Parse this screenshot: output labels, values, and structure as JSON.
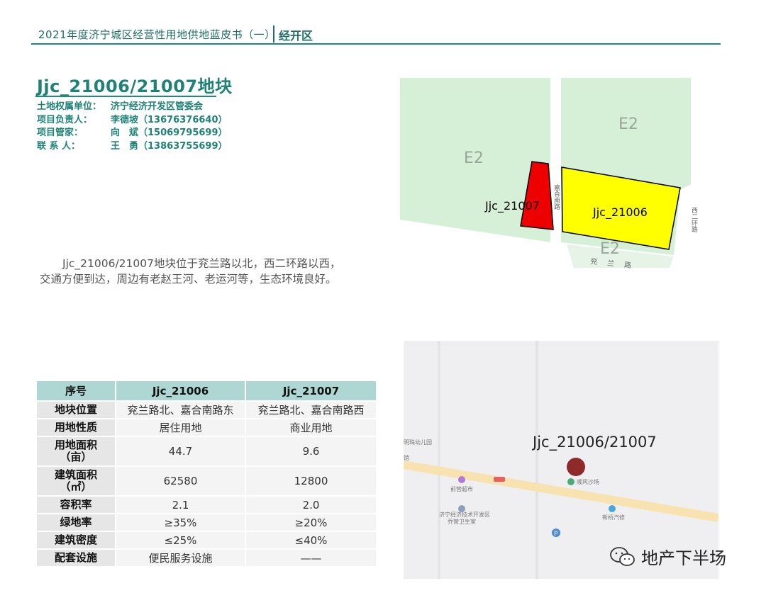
{
  "header": {
    "book_title": "2021年度济宁城区经营性用地供地蓝皮书（一）",
    "district": "经开区"
  },
  "parcel": {
    "title": "Jjc_21006/21007地块",
    "info": [
      {
        "label": "土地权属单位：",
        "value": "济宁经济开发区管委会"
      },
      {
        "label": "项目负责人：",
        "value": "李德坡（13676376640）"
      },
      {
        "label": "项目管家：",
        "value": "向　斌（15069795699）"
      },
      {
        "label": "联 系 人：",
        "value": "王　勇（13863755699）"
      }
    ],
    "description": [
      "Jjc_21006/21007地块位于兖兰路以北，西二环路以西，",
      "交通方便到达，周边有老赵王河、老运河等，生态环境良好。"
    ]
  },
  "planning_map": {
    "zones": [
      "E2",
      "E2",
      "E2"
    ],
    "parcel_21006": "Jjc_21006",
    "parcel_21007": "Jjc_21007",
    "road_jiahe": "嘉合南路",
    "road_xierhuan": "西二环路",
    "road_yanlan": "兖兰路",
    "colors": {
      "green": "#d6f0d8",
      "parcel_21006": "#ffff00",
      "parcel_21007": "#ee0000"
    }
  },
  "location_map": {
    "label": "Jjc_21006/21007",
    "pois": [
      "明珠幼儿园",
      "前营超市",
      "济宁经济技术开发区",
      "乔营卫生室",
      "新桥汽修",
      "顺风沙场",
      "馆"
    ],
    "marker_color": "#8f2a2a"
  },
  "table": {
    "headers": [
      "序号",
      "Jjc_21006",
      "Jjc_21007"
    ],
    "rows": [
      {
        "label": "地块位置",
        "a": "兖兰路北、嘉合南路东",
        "b": "兖兰路北、嘉合南路西",
        "tall": false
      },
      {
        "label": "用地性质",
        "a": "居住用地",
        "b": "商业用地",
        "tall": false
      },
      {
        "label": "用地面积\n（亩）",
        "a": "44.7",
        "b": "9.6",
        "tall": true
      },
      {
        "label": "建筑面积\n（㎡）",
        "a": "62580",
        "b": "12800",
        "tall": true
      },
      {
        "label": "容积率",
        "a": "2.1",
        "b": "2.0",
        "tall": false
      },
      {
        "label": "绿地率",
        "a": "≥35%",
        "b": "≥20%",
        "tall": false
      },
      {
        "label": "建筑密度",
        "a": "≤25%",
        "b": "≤40%",
        "tall": false
      },
      {
        "label": "配套设施",
        "a": "便民服务设施",
        "b": "——",
        "tall": false
      }
    ]
  },
  "watermark": {
    "text": "地产下半场"
  }
}
